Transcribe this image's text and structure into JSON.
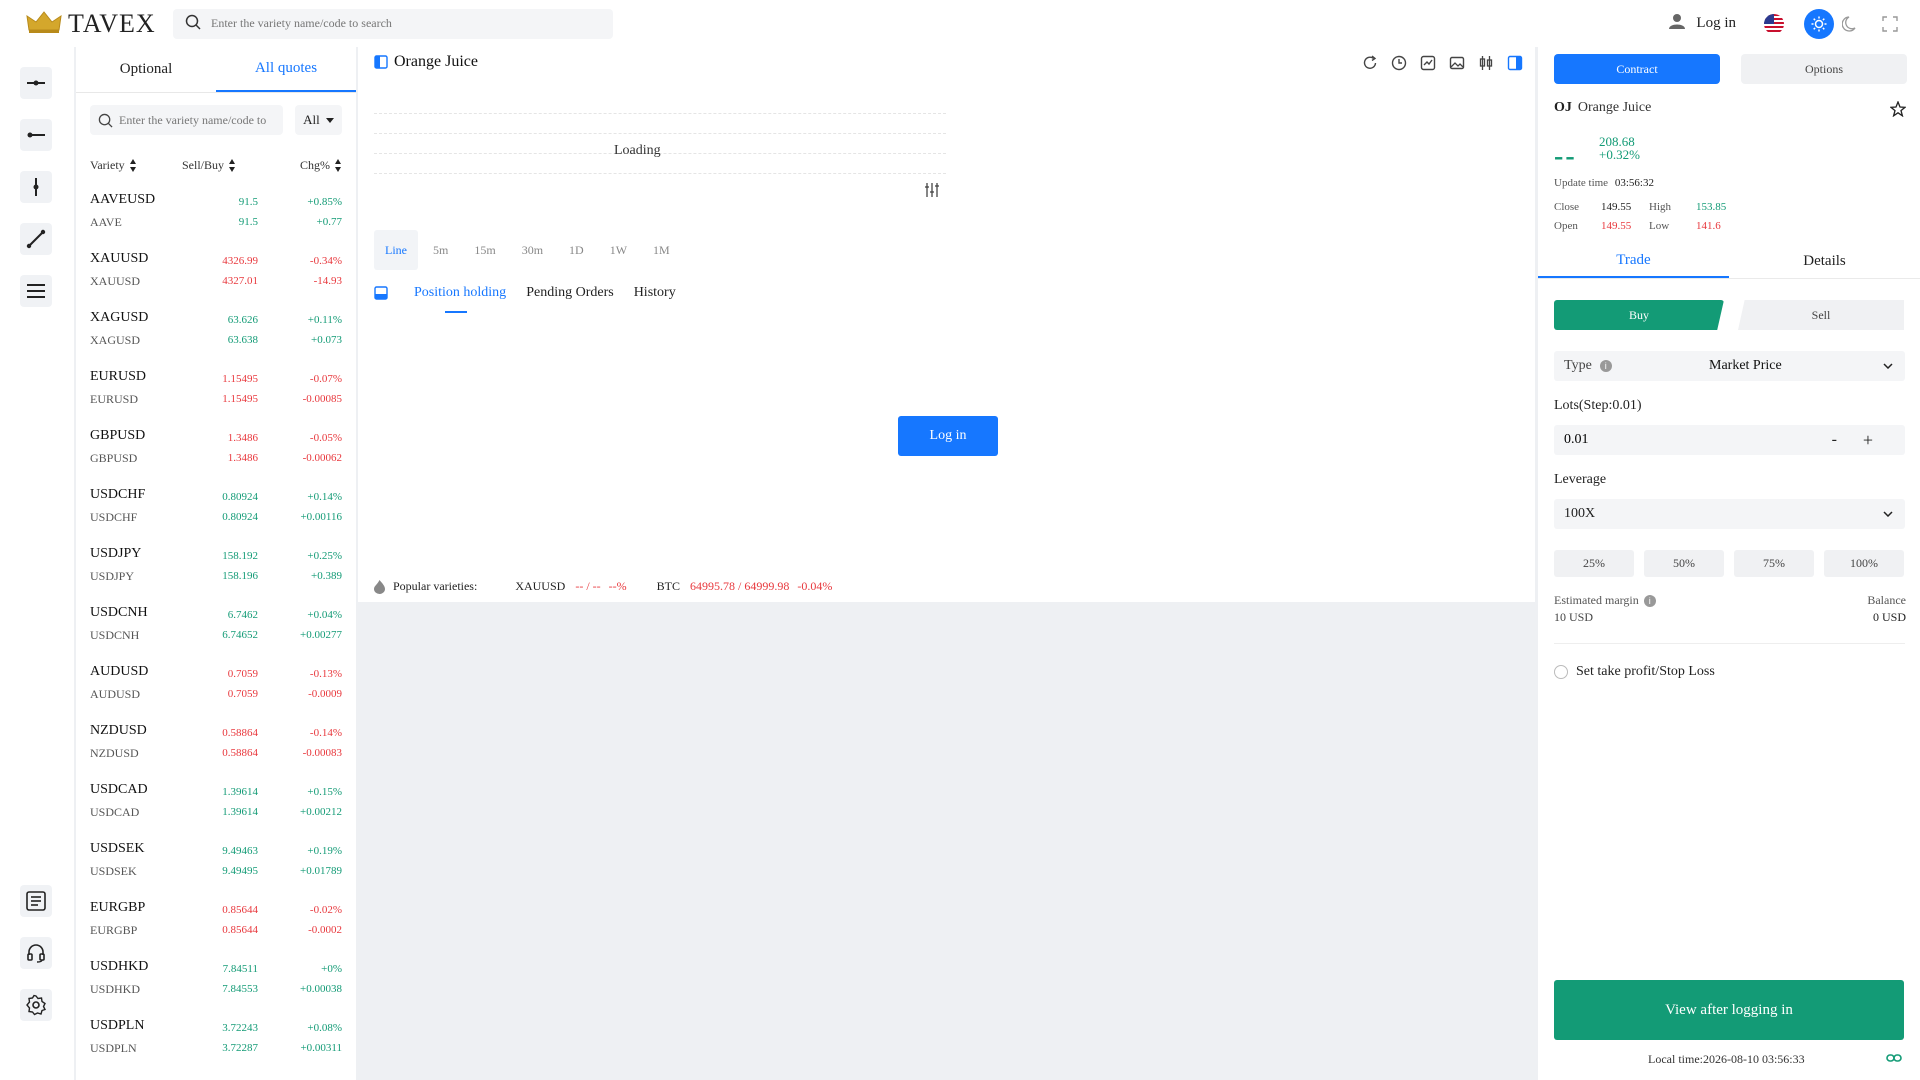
{
  "header": {
    "logo_text": "TAVEX",
    "search_placeholder": "Enter the variety name/code to search",
    "login_label": "Log in"
  },
  "sidebar": {
    "tools": [
      "horizontal-line-tool-icon",
      "ray-tool-icon",
      "vertical-line-tool-icon",
      "trend-line-tool-icon",
      "parallel-lines-tool-icon",
      "news-icon",
      "support-headset-icon",
      "settings-icon"
    ]
  },
  "quotes": {
    "tabs": [
      "Optional",
      "All quotes"
    ],
    "search_placeholder": "Enter the variety name/code to",
    "filter_value": "All",
    "columns": [
      "Variety",
      "Sell/Buy",
      "Chg%"
    ],
    "rows": [
      {
        "name": "AAVEUSD",
        "code": "AAVE",
        "sell": "91.5",
        "buy": "91.5",
        "pct": "+0.85%",
        "chg": "+0.77",
        "dir": "up"
      },
      {
        "name": "XAUUSD",
        "code": "XAUUSD",
        "sell": "4326.99",
        "buy": "4327.01",
        "pct": "-0.34%",
        "chg": "-14.93",
        "dir": "down"
      },
      {
        "name": "XAGUSD",
        "code": "XAGUSD",
        "sell": "63.626",
        "buy": "63.638",
        "pct": "+0.11%",
        "chg": "+0.073",
        "dir": "up"
      },
      {
        "name": "EURUSD",
        "code": "EURUSD",
        "sell": "1.15495",
        "buy": "1.15495",
        "pct": "-0.07%",
        "chg": "-0.00085",
        "dir": "down"
      },
      {
        "name": "GBPUSD",
        "code": "GBPUSD",
        "sell": "1.3486",
        "buy": "1.3486",
        "pct": "-0.05%",
        "chg": "-0.00062",
        "dir": "down"
      },
      {
        "name": "USDCHF",
        "code": "USDCHF",
        "sell": "0.80924",
        "buy": "0.80924",
        "pct": "+0.14%",
        "chg": "+0.00116",
        "dir": "up"
      },
      {
        "name": "USDJPY",
        "code": "USDJPY",
        "sell": "158.192",
        "buy": "158.196",
        "pct": "+0.25%",
        "chg": "+0.389",
        "dir": "up"
      },
      {
        "name": "USDCNH",
        "code": "USDCNH",
        "sell": "6.7462",
        "buy": "6.74652",
        "pct": "+0.04%",
        "chg": "+0.00277",
        "dir": "up"
      },
      {
        "name": "AUDUSD",
        "code": "AUDUSD",
        "sell": "0.7059",
        "buy": "0.7059",
        "pct": "-0.13%",
        "chg": "-0.0009",
        "dir": "down"
      },
      {
        "name": "NZDUSD",
        "code": "NZDUSD",
        "sell": "0.58864",
        "buy": "0.58864",
        "pct": "-0.14%",
        "chg": "-0.00083",
        "dir": "down"
      },
      {
        "name": "USDCAD",
        "code": "USDCAD",
        "sell": "1.39614",
        "buy": "1.39614",
        "pct": "+0.15%",
        "chg": "+0.00212",
        "dir": "up"
      },
      {
        "name": "USDSEK",
        "code": "USDSEK",
        "sell": "9.49463",
        "buy": "9.49495",
        "pct": "+0.19%",
        "chg": "+0.01789",
        "dir": "up"
      },
      {
        "name": "EURGBP",
        "code": "EURGBP",
        "sell": "0.85644",
        "buy": "0.85644",
        "pct": "-0.02%",
        "chg": "-0.0002",
        "dir": "down"
      },
      {
        "name": "USDHKD",
        "code": "USDHKD",
        "sell": "7.84511",
        "buy": "7.84553",
        "pct": "+0%",
        "chg": "+0.00038",
        "dir": "up"
      },
      {
        "name": "USDPLN",
        "code": "USDPLN",
        "sell": "3.72243",
        "buy": "3.72287",
        "pct": "+0.08%",
        "chg": "+0.00311",
        "dir": "up"
      }
    ]
  },
  "chart": {
    "title": "Orange Juice",
    "loading_text": "Loading",
    "periods": [
      "Line",
      "5m",
      "15m",
      "30m",
      "1D",
      "1W",
      "1M"
    ],
    "order_tabs": [
      "Position holding",
      "Pending Orders",
      "History"
    ],
    "login_button": "Log in",
    "popular_label": "Popular varieties:",
    "popular": [
      {
        "name": "XAUUSD",
        "price": "-- / --",
        "chg": "--%"
      },
      {
        "name": "BTC",
        "price": "64995.78 / 64999.98",
        "chg": "-0.04%"
      }
    ]
  },
  "trade": {
    "contract_label": "Contract",
    "options_label": "Options",
    "symbol_code": "OJ",
    "symbol_name": "Orange Juice",
    "price_placeholder": "--",
    "price": "208.68",
    "change_pct": "+0.32%",
    "update_label": "Update time",
    "update_time": "03:56:32",
    "close_label": "Close",
    "close_value": "149.55",
    "high_label": "High",
    "high_value": "153.85",
    "open_label": "Open",
    "open_value": "149.55",
    "low_label": "Low",
    "low_value": "141.6",
    "tabs": [
      "Trade",
      "Details"
    ],
    "buy_label": "Buy",
    "sell_label": "Sell",
    "type_label": "Type",
    "type_value": "Market Price",
    "lots_label": "Lots(Step:0.01)",
    "lots_value": "0.01",
    "minus_label": "-",
    "plus_label": "+",
    "leverage_label": "Leverage",
    "leverage_value": "100X",
    "percent_options": [
      "25%",
      "50%",
      "75%",
      "100%"
    ],
    "margin_label": "Estimated margin",
    "margin_value": "10 USD",
    "balance_label": "Balance",
    "balance_value": "0 USD",
    "tpsl_label": "Set take profit/Stop Loss",
    "view_button": "View after logging in",
    "local_time": "Local time:2026-08-10 03:56:33"
  },
  "colors": {
    "accent": "#1677ff",
    "up": "#139b76",
    "down": "#e8383d",
    "brand_gold": "#c9a227"
  }
}
